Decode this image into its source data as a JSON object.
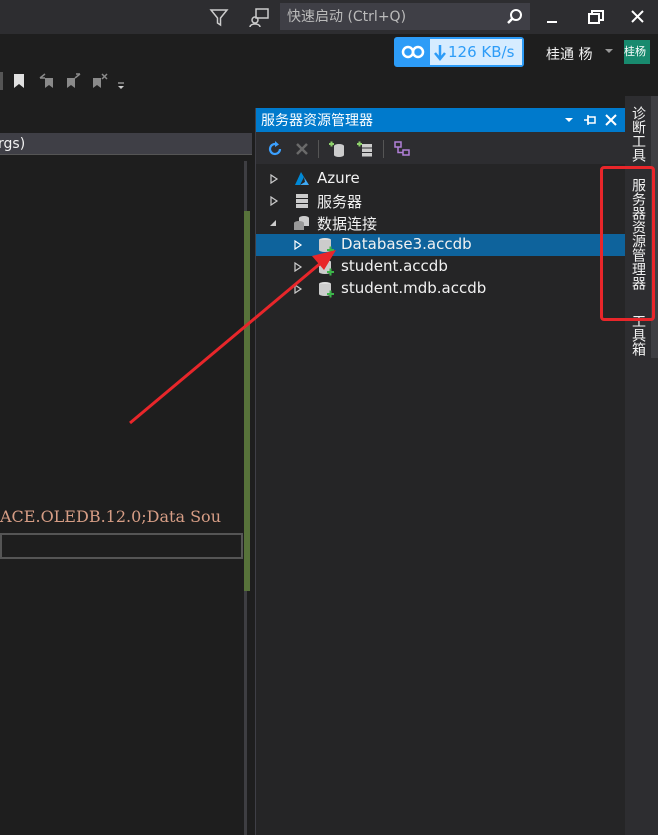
{
  "titlebar": {
    "quick_launch_placeholder": "快速启动 (Ctrl+Q)"
  },
  "netspeed": {
    "value": "126 KB/s"
  },
  "user": {
    "name": "桂通 杨",
    "avatar_text": "桂杨"
  },
  "editor": {
    "tab_text": "rgs)",
    "code_line": "ACE.OLEDB.12.0;Data Sou"
  },
  "server_explorer": {
    "title": "服务器资源管理器",
    "tree": [
      {
        "label": "Azure",
        "icon": "azure-icon"
      },
      {
        "label": "服务器",
        "icon": "server-icon"
      },
      {
        "label": "数据连接",
        "icon": "data-connections-icon"
      },
      {
        "label": "Database3.accdb",
        "icon": "database-icon",
        "selected": true
      },
      {
        "label": "student.accdb",
        "icon": "database-icon"
      },
      {
        "label": "student.mdb.accdb",
        "icon": "database-icon"
      }
    ]
  },
  "side_tabs": {
    "diagnostics": "诊断工具",
    "server_explorer": "服务器资源管理器",
    "toolbox": "工具箱"
  },
  "colors": {
    "accent": "#007acc",
    "annotation": "#e8262a",
    "selection": "#0e639c"
  }
}
